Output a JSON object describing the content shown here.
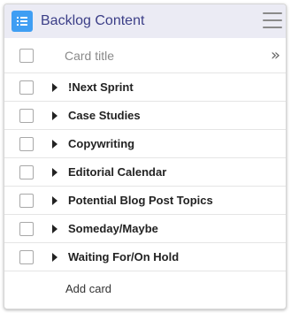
{
  "header": {
    "title": "Backlog Content",
    "logo_icon": "list-icon",
    "menu_icon": "hamburger-menu-icon",
    "accent": "#3f9ef3",
    "title_color": "#3b3e87"
  },
  "columns": {
    "title_label": "Card title",
    "expand_glyph": "»"
  },
  "cards": [
    {
      "title": "!Next Sprint"
    },
    {
      "title": "Case Studies"
    },
    {
      "title": "Copywriting"
    },
    {
      "title": "Editorial Calendar"
    },
    {
      "title": "Potential Blog Post Topics"
    },
    {
      "title": "Someday/Maybe"
    },
    {
      "title": "Waiting For/On Hold"
    }
  ],
  "footer": {
    "add_label": "Add card"
  }
}
